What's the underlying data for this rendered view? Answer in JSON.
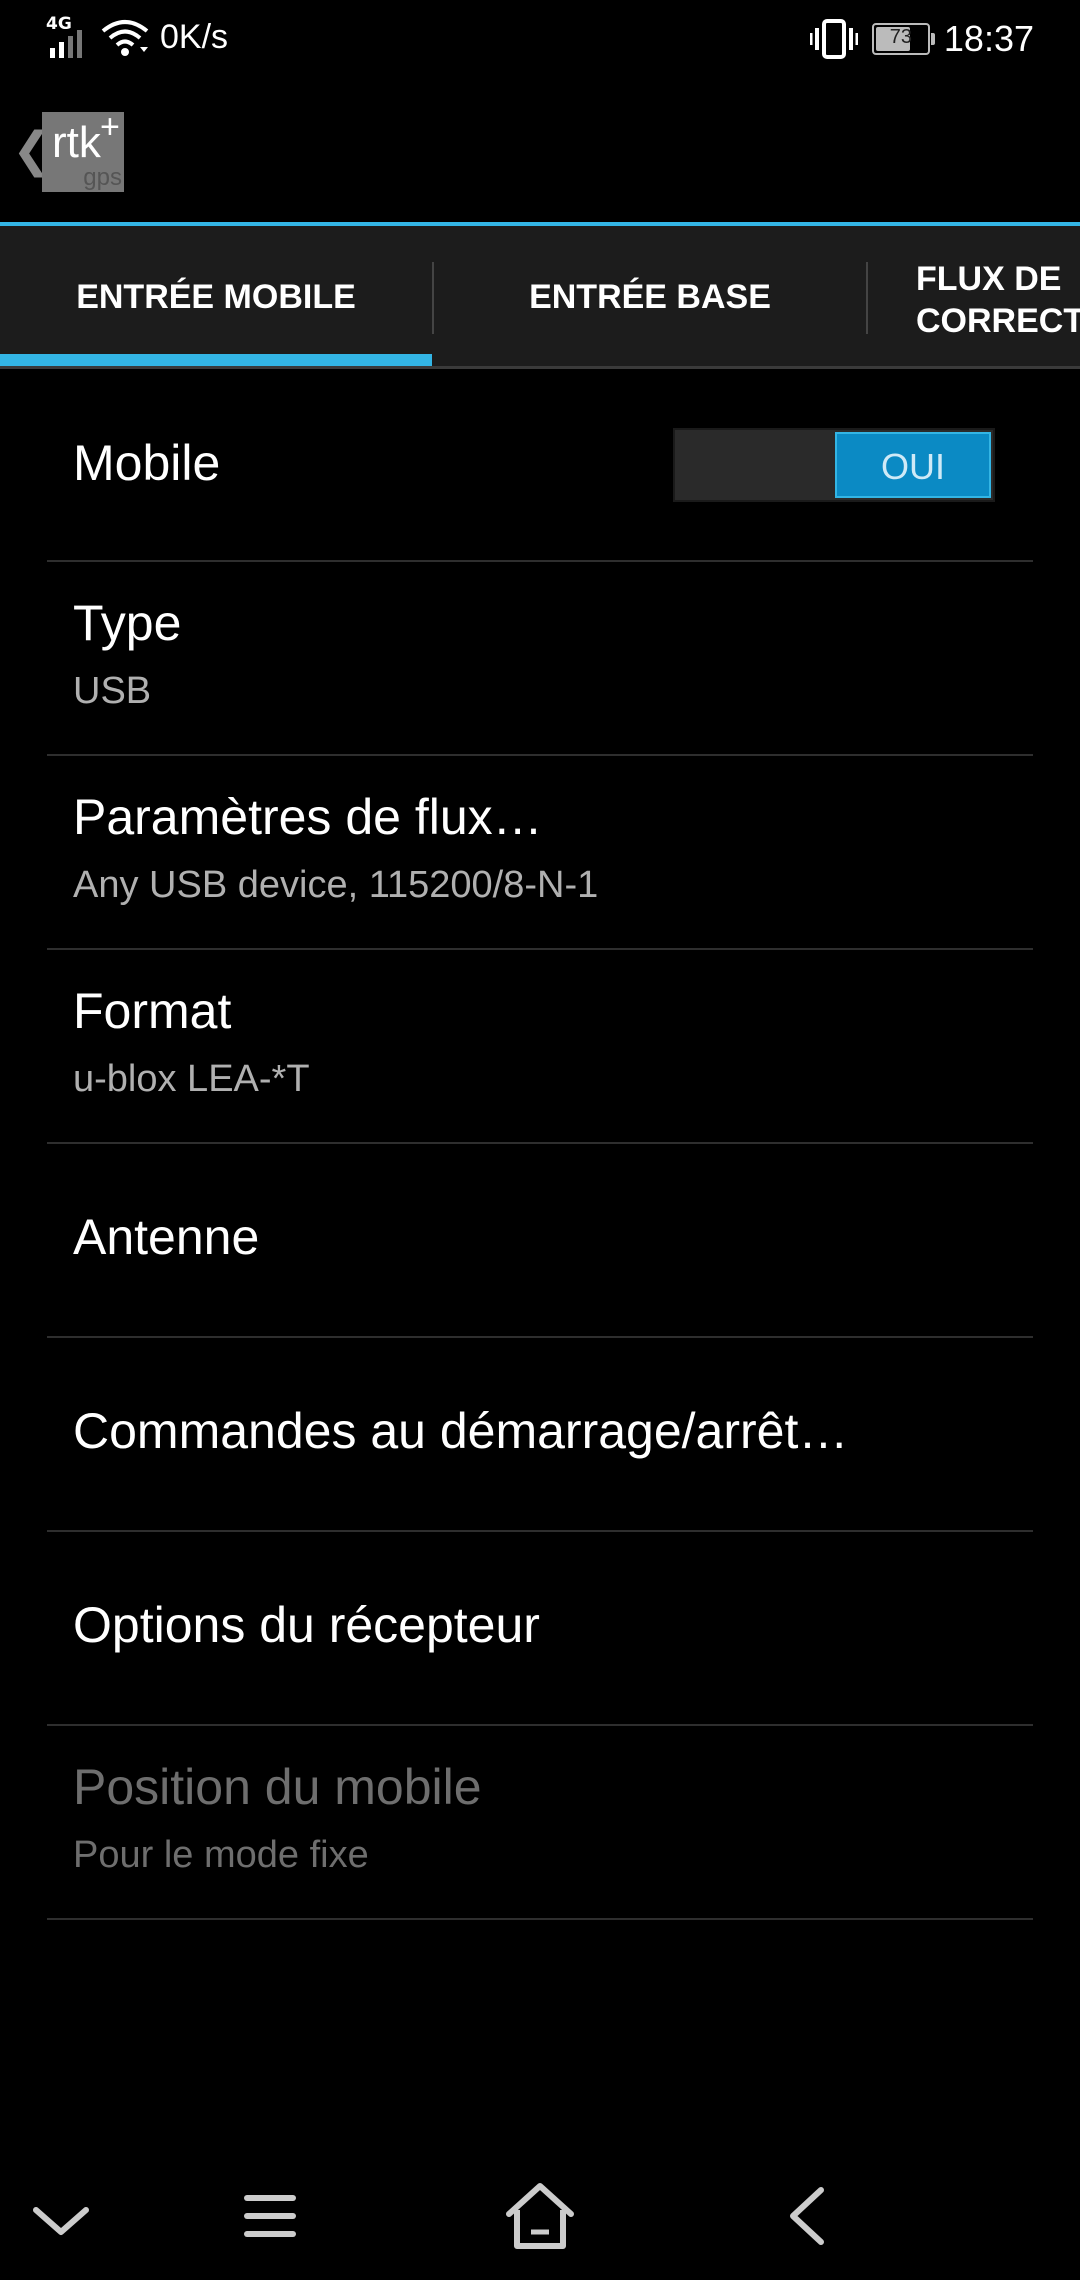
{
  "status_bar": {
    "network_type": "4G",
    "net_speed": "0K/s",
    "battery_percent": "73",
    "battery_level": 0.73,
    "time": "18:37",
    "icons": [
      "signal-icon",
      "wifi-icon",
      "vibrate-icon",
      "battery-icon"
    ]
  },
  "action_bar": {
    "logo_text": "rtk",
    "logo_plus": "+",
    "logo_sub": "gps"
  },
  "tabs": [
    {
      "label": "ENTRÉE MOBILE",
      "selected": true
    },
    {
      "label": "ENTRÉE BASE",
      "selected": false
    },
    {
      "label": "FLUX DE\nCORRECTI",
      "selected": false
    }
  ],
  "accent_color": "#33b5e5",
  "preferences": {
    "mobile": {
      "title": "Mobile",
      "toggle_label": "OUI",
      "toggle_on": true
    },
    "type": {
      "title": "Type",
      "summary": "USB"
    },
    "stream_params": {
      "title": "Paramètres de flux…",
      "summary": "Any USB device, 115200/8-N-1"
    },
    "format": {
      "title": "Format",
      "summary": "u-blox LEA-*T"
    },
    "antenna": {
      "title": "Antenne"
    },
    "commands": {
      "title": "Commandes au démarrage/arrêt…"
    },
    "receiver_options": {
      "title": "Options du récepteur"
    },
    "mobile_position": {
      "title": "Position du mobile",
      "summary": "Pour le mode fixe",
      "enabled": false
    }
  },
  "nav_bar": {
    "icons": [
      "chevron-down-icon",
      "menu-icon",
      "home-icon",
      "back-icon"
    ]
  }
}
